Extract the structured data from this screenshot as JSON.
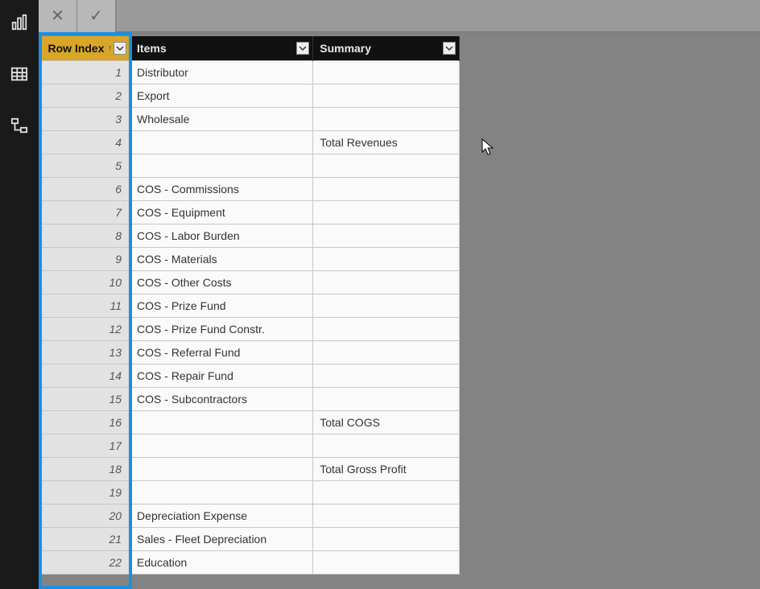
{
  "sidebar": {
    "items": [
      "report-view",
      "data-view",
      "model-view"
    ]
  },
  "formula_bar": {
    "cancel": "✕",
    "commit": "✓"
  },
  "columns": [
    {
      "label": "Row Index",
      "sorted_asc": true,
      "selected": true
    },
    {
      "label": "Items",
      "sorted_asc": false,
      "selected": false
    },
    {
      "label": "Summary",
      "sorted_asc": false,
      "selected": false
    }
  ],
  "rows": [
    {
      "index": "1",
      "items": "Distributor",
      "summary": ""
    },
    {
      "index": "2",
      "items": "Export",
      "summary": ""
    },
    {
      "index": "3",
      "items": "Wholesale",
      "summary": ""
    },
    {
      "index": "4",
      "items": "",
      "summary": "Total Revenues"
    },
    {
      "index": "5",
      "items": "",
      "summary": ""
    },
    {
      "index": "6",
      "items": "COS - Commissions",
      "summary": ""
    },
    {
      "index": "7",
      "items": "COS - Equipment",
      "summary": ""
    },
    {
      "index": "8",
      "items": "COS - Labor Burden",
      "summary": ""
    },
    {
      "index": "9",
      "items": "COS - Materials",
      "summary": ""
    },
    {
      "index": "10",
      "items": "COS - Other Costs",
      "summary": ""
    },
    {
      "index": "11",
      "items": "COS - Prize Fund",
      "summary": ""
    },
    {
      "index": "12",
      "items": "COS - Prize Fund Constr.",
      "summary": ""
    },
    {
      "index": "13",
      "items": "COS - Referral Fund",
      "summary": ""
    },
    {
      "index": "14",
      "items": "COS - Repair Fund",
      "summary": ""
    },
    {
      "index": "15",
      "items": "COS - Subcontractors",
      "summary": ""
    },
    {
      "index": "16",
      "items": "",
      "summary": "Total COGS"
    },
    {
      "index": "17",
      "items": "",
      "summary": ""
    },
    {
      "index": "18",
      "items": "",
      "summary": "Total Gross Profit"
    },
    {
      "index": "19",
      "items": "",
      "summary": ""
    },
    {
      "index": "20",
      "items": "Depreciation Expense",
      "summary": ""
    },
    {
      "index": "21",
      "items": "Sales - Fleet Depreciation",
      "summary": ""
    },
    {
      "index": "22",
      "items": "Education",
      "summary": ""
    }
  ]
}
